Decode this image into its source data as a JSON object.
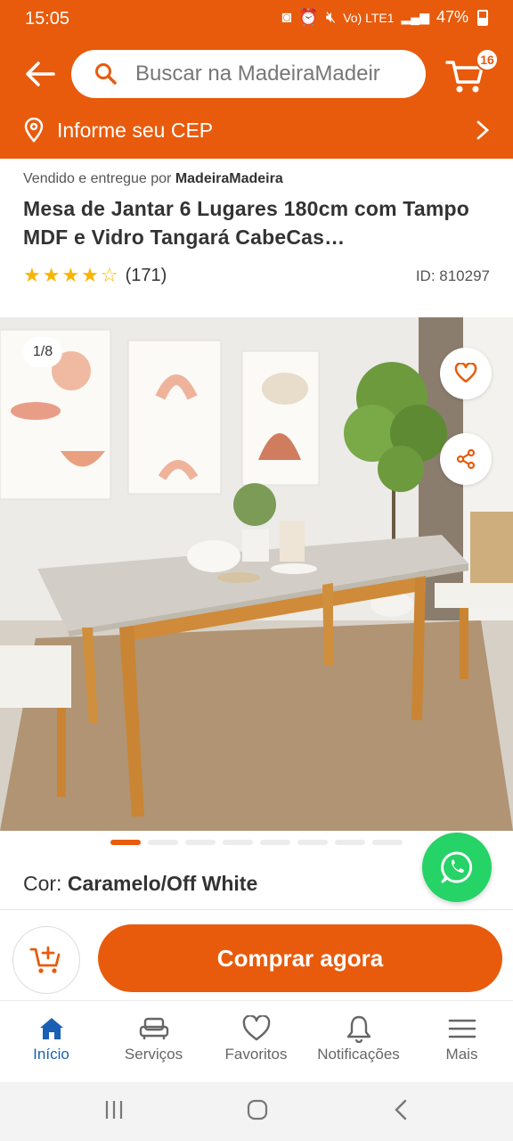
{
  "status": {
    "time": "15:05",
    "battery": "47%",
    "network": "Vo) LTE1"
  },
  "header": {
    "search_placeholder": "Buscar na MadeiraMadeir",
    "cart_count": "16",
    "cep_label": "Informe seu CEP"
  },
  "product": {
    "seller_prefix": "Vendido e entregue por",
    "seller_name": "MadeiraMadeira",
    "title": "Mesa de Jantar 6 Lugares 180cm com Tampo MDF e Vidro Tangará CabeCas…",
    "stars": "★★★★☆",
    "rating_value": 4.5,
    "rating_count": "(171)",
    "id_label": "ID: 810297",
    "image_counter": "1/8",
    "color_label": "Cor:",
    "color_value": "Caramelo/Off White"
  },
  "gallery": {
    "total": 8,
    "current": 1
  },
  "actions": {
    "buy_label": "Comprar agora"
  },
  "bottom_nav": {
    "items": [
      {
        "label": "Início",
        "icon": "home-icon",
        "active": true
      },
      {
        "label": "Serviços",
        "icon": "sofa-icon",
        "active": false
      },
      {
        "label": "Favoritos",
        "icon": "heart-icon",
        "active": false
      },
      {
        "label": "Notificações",
        "icon": "bell-icon",
        "active": false
      },
      {
        "label": "Mais",
        "icon": "menu-icon",
        "active": false
      }
    ]
  },
  "colors": {
    "brand": "#e85b0c",
    "active_nav": "#1a5fb4",
    "whatsapp": "#25d366",
    "star": "#f7b500"
  }
}
